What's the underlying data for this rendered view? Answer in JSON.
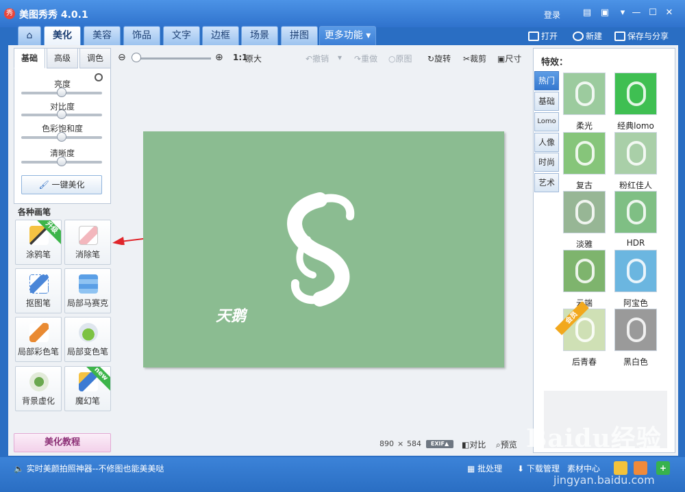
{
  "app": {
    "logo": "秀",
    "title": "美图秀秀 4.0.1",
    "login": "登录"
  },
  "tabs": [
    "美化",
    "美容",
    "饰品",
    "文字",
    "边框",
    "场景",
    "拼图",
    "更多功能"
  ],
  "top_right": {
    "open": "打开",
    "new": "新建",
    "save_share": "保存与分享"
  },
  "left": {
    "subtabs": [
      "基础",
      "高级",
      "调色"
    ],
    "sliders": [
      {
        "label": "亮度",
        "level": 0.5
      },
      {
        "label": "对比度",
        "level": 0.5
      },
      {
        "label": "色彩饱和度",
        "level": 0.5
      },
      {
        "label": "清晰度",
        "level": 0.5
      }
    ],
    "one_key": "一键美化",
    "brush_title": "各种画笔",
    "brushes": [
      {
        "label": "涂鸦笔",
        "badge": "升级",
        "icon": "pen-icon"
      },
      {
        "label": "消除笔",
        "badge": "",
        "icon": "eraser-icon"
      },
      {
        "label": "抠图笔",
        "badge": "",
        "icon": "cutout-pen-icon"
      },
      {
        "label": "局部马赛克",
        "badge": "",
        "icon": "mosaic-icon"
      },
      {
        "label": "局部彩色笔",
        "badge": "",
        "icon": "color-brush-icon"
      },
      {
        "label": "局部变色笔",
        "badge": "",
        "icon": "bucket-icon"
      },
      {
        "label": "背景虚化",
        "badge": "",
        "icon": "blur-icon"
      },
      {
        "label": "魔幻笔",
        "badge": "new",
        "icon": "magic-pen-icon"
      }
    ],
    "tutorial": "美化教程"
  },
  "canvas": {
    "zoom_actual": "1:1",
    "actual_label": "原大",
    "undo": "撤销",
    "redo": "重做",
    "original": "原图",
    "rotate": "旋转",
    "crop": "裁剪",
    "size": "尺寸",
    "photo_text": "天鹅",
    "width": "890",
    "x": "×",
    "height": "584",
    "exif": "EXIF▲",
    "compare": "对比",
    "preview": "预览"
  },
  "effects": {
    "title": "特效：",
    "categories": [
      "热门",
      "基础",
      "Lomo",
      "人像",
      "时尚",
      "艺术"
    ],
    "items": [
      {
        "label": "柔光",
        "color": "#9ccb9e"
      },
      {
        "label": "经典lomo",
        "color": "#3fbf52"
      },
      {
        "label": "复古",
        "color": "#86c57a"
      },
      {
        "label": "粉红佳人",
        "color": "#a9cfa8"
      },
      {
        "label": "淡雅",
        "color": "#97b695"
      },
      {
        "label": "HDR",
        "color": "#7fbf84"
      },
      {
        "label": "云端",
        "color": "#7eb46d"
      },
      {
        "label": "阿宝色",
        "color": "#6bb6e0"
      },
      {
        "label": "后青春",
        "color": "#cfe0b5",
        "badge": "会员"
      },
      {
        "label": "黑白色",
        "color": "#9a9a9a"
      }
    ]
  },
  "status": {
    "tip": "实时美颜拍照神器--不修图也能美美哒",
    "batch": "批处理",
    "download": "下载管理",
    "material": "素材中心"
  },
  "watermark": {
    "brand": "Baidu经验",
    "url": "jingyan.baidu.com"
  }
}
